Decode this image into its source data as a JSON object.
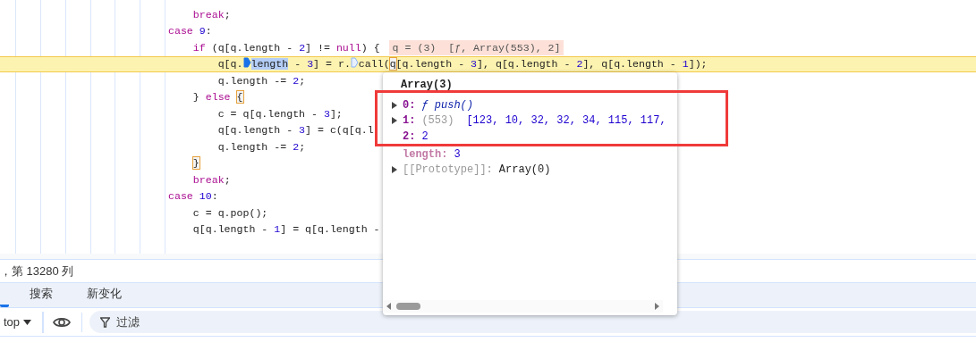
{
  "code_lines": [
    {
      "highlighted": false,
      "tokens": [
        {
          "kind": "keyword",
          "text": "    break"
        },
        {
          "kind": "plain",
          "text": ";"
        }
      ]
    },
    {
      "highlighted": false,
      "tokens": [
        {
          "kind": "keyword",
          "text": "case"
        },
        {
          "kind": "number",
          "text": " 9"
        },
        {
          "kind": "plain",
          "text": ":"
        }
      ]
    },
    {
      "highlighted": false,
      "inline_value": "q = (3)  [ƒ, Array(553), 2]",
      "tokens": [
        {
          "kind": "keyword",
          "text": "    if"
        },
        {
          "kind": "plain",
          "text": " (q[q.length - "
        },
        {
          "kind": "number",
          "text": "2"
        },
        {
          "kind": "plain",
          "text": "] != "
        },
        {
          "kind": "keyword",
          "text": "null"
        },
        {
          "kind": "plain",
          "text": ") {"
        }
      ]
    },
    {
      "highlighted": true,
      "tokens": [
        {
          "kind": "plain",
          "text": "        q[q."
        },
        {
          "kind": "marker",
          "selected": true
        },
        {
          "kind": "selection",
          "text": "length"
        },
        {
          "kind": "plain",
          "text": " - "
        },
        {
          "kind": "number",
          "text": "3"
        },
        {
          "kind": "plain",
          "text": "] = r."
        },
        {
          "kind": "marker",
          "selected": false
        },
        {
          "kind": "plain",
          "text": "call("
        },
        {
          "kind": "boxed",
          "text": "q"
        },
        {
          "kind": "plain",
          "text": "[q.length - "
        },
        {
          "kind": "number",
          "text": "3"
        },
        {
          "kind": "plain",
          "text": "], q[q.length - "
        },
        {
          "kind": "number",
          "text": "2"
        },
        {
          "kind": "plain",
          "text": "], q[q.length - "
        },
        {
          "kind": "number",
          "text": "1"
        },
        {
          "kind": "plain",
          "text": "]);"
        }
      ]
    },
    {
      "highlighted": false,
      "tokens": [
        {
          "kind": "plain",
          "text": "        q.length -= "
        },
        {
          "kind": "number",
          "text": "2"
        },
        {
          "kind": "plain",
          "text": ";"
        }
      ]
    },
    {
      "highlighted": false,
      "tokens": [
        {
          "kind": "plain",
          "text": "    } "
        },
        {
          "kind": "keyword",
          "text": "else "
        },
        {
          "kind": "boxed",
          "text": "{"
        }
      ]
    },
    {
      "highlighted": false,
      "tokens": [
        {
          "kind": "plain",
          "text": "        c = q[q.length - "
        },
        {
          "kind": "number",
          "text": "3"
        },
        {
          "kind": "plain",
          "text": "];"
        }
      ]
    },
    {
      "highlighted": false,
      "tokens": [
        {
          "kind": "plain",
          "text": "        q[q.length - "
        },
        {
          "kind": "number",
          "text": "3"
        },
        {
          "kind": "plain",
          "text": "] = c(q[q.l"
        }
      ]
    },
    {
      "highlighted": false,
      "tokens": [
        {
          "kind": "plain",
          "text": "        q.length -= "
        },
        {
          "kind": "number",
          "text": "2"
        },
        {
          "kind": "plain",
          "text": ";"
        }
      ]
    },
    {
      "highlighted": false,
      "tokens": [
        {
          "kind": "boxed",
          "text": "    }"
        }
      ]
    },
    {
      "highlighted": false,
      "tokens": [
        {
          "kind": "keyword",
          "text": "    break"
        },
        {
          "kind": "plain",
          "text": ";"
        }
      ]
    },
    {
      "highlighted": false,
      "tokens": [
        {
          "kind": "keyword",
          "text": "case"
        },
        {
          "kind": "number",
          "text": " 10"
        },
        {
          "kind": "plain",
          "text": ":"
        }
      ]
    },
    {
      "highlighted": false,
      "tokens": [
        {
          "kind": "plain",
          "text": "    c = q.pop();"
        }
      ]
    },
    {
      "highlighted": false,
      "tokens": [
        {
          "kind": "plain",
          "text": "    q[q.length - "
        },
        {
          "kind": "number",
          "text": "1"
        },
        {
          "kind": "plain",
          "text": "] = q[q.length -"
        }
      ]
    }
  ],
  "status_bar": {
    "position": "，第 13280 列"
  },
  "tabs": [
    {
      "selected": true
    },
    {
      "label": "搜索",
      "selected": false
    },
    {
      "label": "新变化",
      "selected": false
    }
  ],
  "toolbar": {
    "context": "top",
    "filter": {
      "placeholder": "过滤"
    }
  },
  "popover": {
    "title": "Array(3)",
    "rows": [
      {
        "kind": "function",
        "key": "0:",
        "value": "ƒ push()",
        "expandable": true
      },
      {
        "kind": "array",
        "key": "1:",
        "count": "(553)",
        "value": "[123, 10, 32, 32, 34, 115, 117,",
        "expandable": true
      },
      {
        "kind": "number",
        "key": "2:",
        "value": "2",
        "expandable": false
      },
      {
        "kind": "hidden",
        "key": "length:",
        "value": "3",
        "expandable": false
      },
      {
        "kind": "internal",
        "key": "[[Prototype]]:",
        "value": "Array(0)",
        "expandable": true
      }
    ]
  }
}
